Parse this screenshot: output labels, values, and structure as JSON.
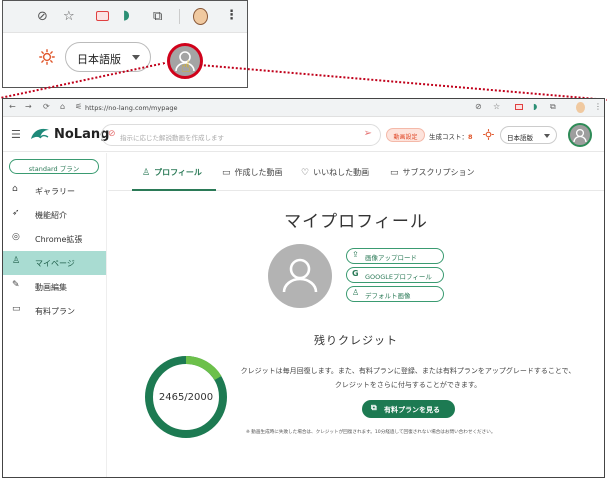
{
  "colors": {
    "accent": "#2b7a57",
    "accent_dark": "#1d7a52",
    "active_bg": "#a9dcd2",
    "highlight_red": "#c0001a",
    "orange": "#e0572c"
  },
  "callout": {
    "lang_selector": "日本語版",
    "icons": [
      "eye-off-icon",
      "star-icon",
      "extension-red-icon",
      "dolphin-icon",
      "puzzle-icon",
      "profile-face-icon",
      "more-vert-icon",
      "sun-icon",
      "avatar-icon",
      "hand-cursor-icon"
    ]
  },
  "browser": {
    "url": "https://no-lang.com/mypage",
    "icons": [
      "back-icon",
      "forward-icon",
      "reload-icon",
      "home-icon",
      "site-info-icon"
    ]
  },
  "header": {
    "logo_text": "NoLang",
    "prompt_placeholder": "指示に応じた解説動画を作成します",
    "video_settings_label": "動画設定",
    "cost_label": "生成コスト：",
    "cost_value": "8",
    "language": "日本語版"
  },
  "sidebar": {
    "plan_badge": "standard プラン",
    "items": [
      {
        "label": "ギャラリー",
        "icon": "home-icon"
      },
      {
        "label": "機能紹介",
        "icon": "rocket-icon"
      },
      {
        "label": "Chrome拡張",
        "icon": "chrome-icon"
      },
      {
        "label": "マイページ",
        "icon": "person-icon",
        "active": true
      },
      {
        "label": "動画編集",
        "icon": "pencil-icon"
      },
      {
        "label": "有料プラン",
        "icon": "card-icon"
      }
    ]
  },
  "tabs": [
    {
      "label": "プロフィール",
      "icon": "person-icon",
      "active": true
    },
    {
      "label": "作成した動画",
      "icon": "video-icon"
    },
    {
      "label": "いいねした動画",
      "icon": "heart-icon"
    },
    {
      "label": "サブスクリプション",
      "icon": "card-icon"
    }
  ],
  "profile": {
    "title": "マイプロフィール",
    "buttons": [
      {
        "label": "画像アップロード",
        "icon": "upload-icon"
      },
      {
        "label": "GOOGLEプロフィール",
        "icon": "google-icon"
      },
      {
        "label": "デフォルト画像",
        "icon": "person-icon"
      }
    ]
  },
  "credits": {
    "title": "残りクレジット",
    "remaining": 2465,
    "total": 2000,
    "display": "2465/2000",
    "description": "クレジットは毎月回復します。また、有料プランに登録、または有料プランをアップグレードすることで、クレジットをさらに付与することができます。",
    "plans_button": "有料プランを見る",
    "note": "※ 動画生成時に失敗した場合は、クレジットが回復されます。10分経過して回復されない場合はお問い合わせください。"
  }
}
